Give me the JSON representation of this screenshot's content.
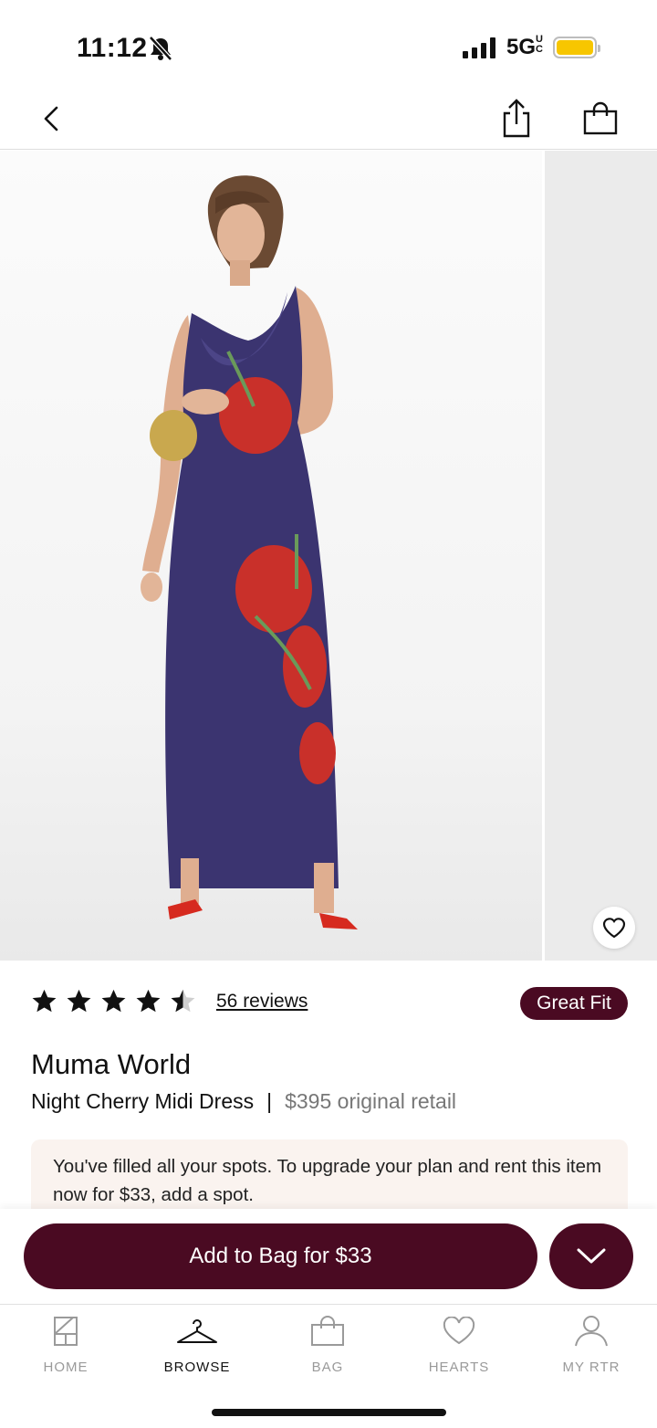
{
  "status_bar": {
    "time": "11:12",
    "network": "5G",
    "network_sup": "UC",
    "icons": [
      "bell-muted-icon",
      "signal-icon",
      "battery-icon"
    ],
    "battery_color": "#f7c600"
  },
  "nav": {
    "icons": [
      "back-chevron-icon",
      "share-icon",
      "shopping-bag-icon"
    ]
  },
  "product": {
    "rating_stars": 4.5,
    "reviews_label": "56 reviews",
    "fit_badge": "Great Fit",
    "brand": "Muma World",
    "name": "Night Cherry Midi Dress",
    "separator": "|",
    "retail": "$395 original retail",
    "notice": "You've filled all your spots. To upgrade your plan and rent this item now for $33, add a spot."
  },
  "cta": {
    "label": "Add to Bag for $33",
    "toggle_icon": "chevron-down-icon"
  },
  "tabs": [
    {
      "label": "HOME",
      "icon": "home-icon",
      "active": false
    },
    {
      "label": "BROWSE",
      "icon": "hanger-icon",
      "active": true
    },
    {
      "label": "BAG",
      "icon": "bag-icon",
      "active": false
    },
    {
      "label": "HEARTS",
      "icon": "heart-icon",
      "active": false
    },
    {
      "label": "MY RTR",
      "icon": "person-icon",
      "active": false
    }
  ],
  "colors": {
    "brand": "#4a0a22",
    "notice_bg": "#faf3ef",
    "dress": "#3b3470",
    "cherry": "#c9302a"
  }
}
